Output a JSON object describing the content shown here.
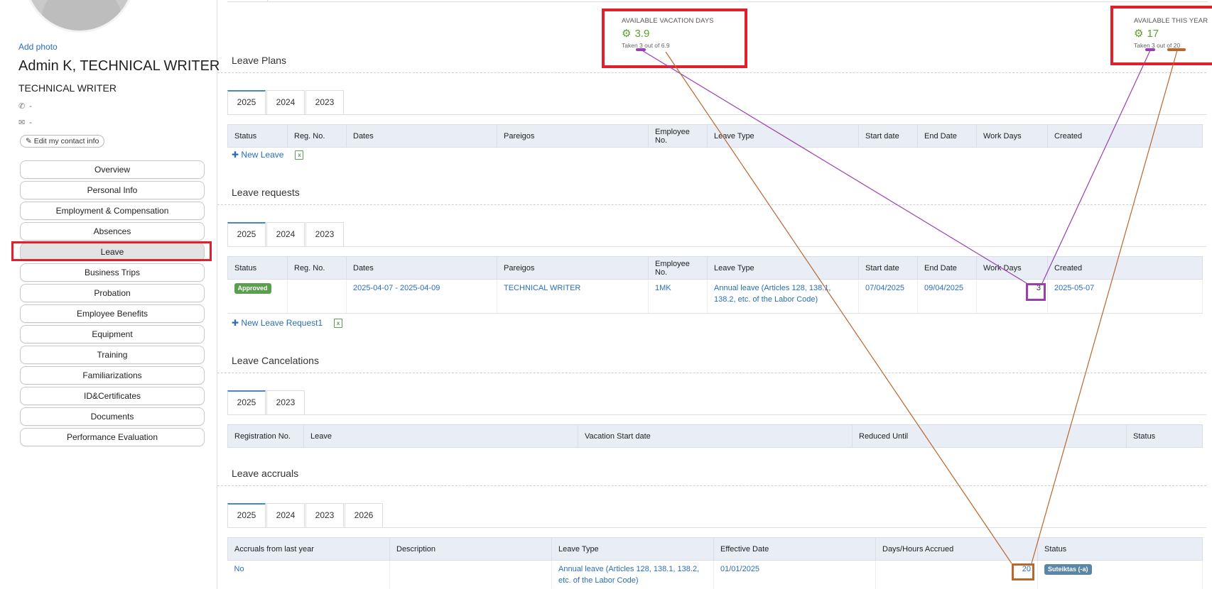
{
  "profile": {
    "add_photo": "Add photo",
    "name": "Admin K, TECHNICAL WRITER",
    "title": "TECHNICAL WRITER",
    "phone": "-",
    "email": "-",
    "edit_contact": "Edit my contact info"
  },
  "nav": {
    "items": [
      "Overview",
      "Personal Info",
      "Employment & Compensation",
      "Absences",
      "Leave",
      "Business Trips",
      "Probation",
      "Employee Benefits",
      "Equipment",
      "Training",
      "Familiarizations",
      "ID&Certificates",
      "Documents",
      "Performance Evaluation"
    ],
    "active": "Leave"
  },
  "kpis": {
    "vacation": {
      "caption": "AVAILABLE VACATION DAYS",
      "value": "3.9",
      "sub": "Taken 3 out of 6.9"
    },
    "this_year": {
      "caption": "AVAILABLE THIS YEAR",
      "value": "17",
      "sub": "Taken 3 out of 20"
    }
  },
  "leave_plans": {
    "title": "Leave Plans",
    "tabs": [
      "2025",
      "2024",
      "2023"
    ],
    "columns": [
      "Status",
      "Reg. No.",
      "Dates",
      "Pareigos",
      "Employee No.",
      "Leave Type",
      "Start date",
      "End Date",
      "Work Days",
      "Created"
    ],
    "action": "New Leave"
  },
  "leave_requests": {
    "title": "Leave requests",
    "tabs": [
      "2025",
      "2024",
      "2023"
    ],
    "columns": [
      "Status",
      "Reg. No.",
      "Dates",
      "Pareigos",
      "Employee No.",
      "Leave Type",
      "Start date",
      "End Date",
      "Work Days",
      "Created"
    ],
    "row": {
      "status": "Approved",
      "reg_no": "",
      "dates": "2025-04-07 - 2025-04-09",
      "position": "TECHNICAL WRITER",
      "employee_no": "1MK",
      "leave_type": "Annual leave (Articles 128, 138.1, 138.2, etc. of the Labor Code)",
      "start": "07/04/2025",
      "end": "09/04/2025",
      "work_days": "3",
      "created": "2025-05-07"
    },
    "action": "New Leave Request1"
  },
  "leave_cancelations": {
    "title": "Leave Cancelations",
    "tabs": [
      "2025",
      "2023"
    ],
    "columns": [
      "Registration No.",
      "Leave",
      "Vacation Start date",
      "Reduced Until",
      "Status"
    ]
  },
  "leave_accruals": {
    "title": "Leave accruals",
    "tabs": [
      "2025",
      "2024",
      "2023",
      "2026"
    ],
    "columns": [
      "Accruals from last year",
      "Description",
      "Leave Type",
      "Effective Date",
      "Days/Hours Accrued",
      "Status"
    ],
    "row": {
      "from_last_year": "No",
      "description": "",
      "leave_type": "Annual leave (Articles 128, 138.1, 138.2, etc. of the Labor Code)",
      "effective_date": "01/01/2025",
      "accrued": "20",
      "status": "Suteiktas (-a)"
    }
  },
  "colors": {
    "highlight_red": "#e0202a",
    "link_purple": "#9b3fb0",
    "link_brown": "#b8672e",
    "approved_green": "#5a9e4e",
    "status_blue": "#5a87a8",
    "link_blue": "#2a6eb7"
  },
  "icons": [
    "phone-icon",
    "envelope-icon",
    "edit-icon",
    "plus-icon",
    "excel-icon",
    "gear-icon"
  ]
}
